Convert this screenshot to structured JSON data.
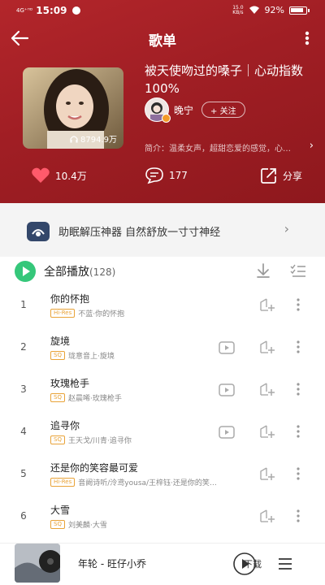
{
  "status": {
    "network": "4G⁺ᴴᴰ",
    "time": "15:09",
    "speed_top": "15.0",
    "speed_bottom": "KB/s",
    "battery": "92%"
  },
  "nav": {
    "title": "歌单"
  },
  "playlist": {
    "title": "被天使吻过的嗓子｜心动指数100%",
    "play_count": "8794.9万",
    "creator_name": "晚宁",
    "follow_label": "+ 关注",
    "intro": "简介：温柔女声，超甜恋爱的感觉，心…"
  },
  "stats": {
    "likes": "10.4万",
    "comments": "177",
    "share_label": "分享"
  },
  "promo": {
    "text": "助眠解压神器 自然舒放一寸寸神经"
  },
  "list_header": {
    "play_all_label": "全部播放",
    "count": "(128)"
  },
  "songs": [
    {
      "num": "1",
      "title": "你的怀抱",
      "badge": "Hi-Res",
      "artist": "不蓝·你的怀抱",
      "has_mv": false
    },
    {
      "num": "2",
      "title": "旋境",
      "badge": "SQ",
      "artist": "珑意音上·旋境",
      "has_mv": true
    },
    {
      "num": "3",
      "title": "玫瑰枪手",
      "badge": "SQ",
      "artist": "赵晨唏·玫瑰枪手",
      "has_mv": true
    },
    {
      "num": "4",
      "title": "追寻你",
      "badge": "SQ",
      "artist": "王天戈/川青·追寻你",
      "has_mv": true
    },
    {
      "num": "5",
      "title": "还是你的笑容最可爱",
      "badge": "Hi-Res",
      "artist": "音阙诗听/泠鸢yousa/王梓钰·还是你的笑…",
      "has_mv": false
    },
    {
      "num": "6",
      "title": "大雪",
      "badge": "SQ",
      "artist": "刘美麟·大雪",
      "has_mv": false
    }
  ],
  "mini_player": {
    "now_playing": "年轮 - 旺仔小乔"
  },
  "watermark": "下载",
  "colors": {
    "hero_red": "#a01e24",
    "play_green": "#35c77a",
    "badge_gold": "#e9a338"
  },
  "icons": [
    "back-arrow-icon",
    "more-vertical-icon",
    "headphone-icon",
    "heart-icon",
    "comment-icon",
    "share-icon",
    "download-icon",
    "multiselect-icon",
    "mv-icon",
    "add-to-playlist-icon",
    "play-icon",
    "playlist-icon"
  ]
}
